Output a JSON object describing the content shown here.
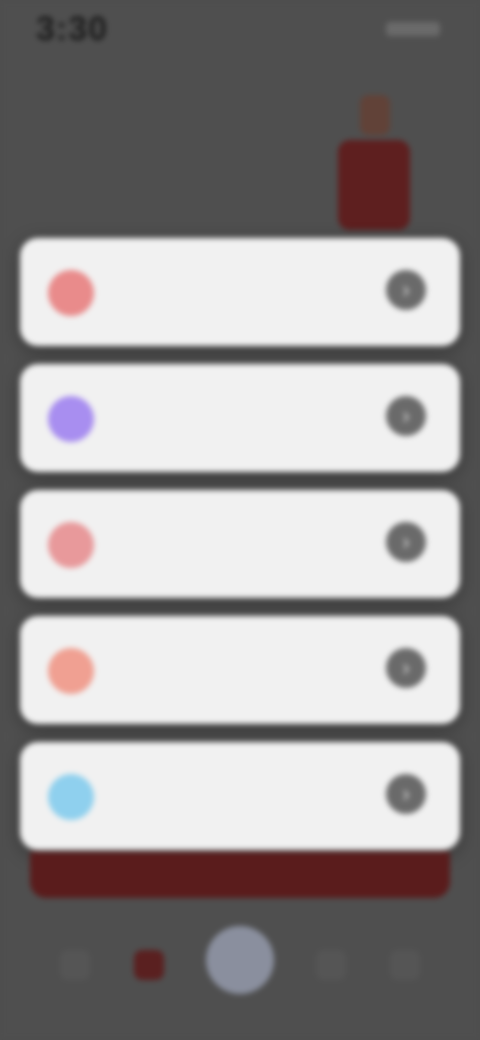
{
  "status_bar": {
    "time": "3:30"
  },
  "header": {
    "title": "",
    "graphic_color": "#5e1f1f"
  },
  "cards": [
    {
      "label": "",
      "icon": "status-dot-icon",
      "icon_color": "#e98b8b",
      "action_icon": "chevron-right-icon"
    },
    {
      "label": "",
      "icon": "status-dot-icon",
      "icon_color": "#a88ef0",
      "action_icon": "chevron-right-icon"
    },
    {
      "label": "",
      "icon": "status-dot-icon",
      "icon_color": "#e8999b",
      "action_icon": "chevron-right-icon"
    },
    {
      "label": "",
      "icon": "status-dot-icon",
      "icon_color": "#f0a092",
      "action_icon": "chevron-right-icon"
    },
    {
      "label": "",
      "icon": "status-dot-icon",
      "icon_color": "#8fd0ee",
      "action_icon": "chevron-right-icon"
    }
  ],
  "bottom_banner": {
    "color": "#5a1c1c"
  },
  "bottom_nav": {
    "items": [
      "home-icon",
      "stats-icon",
      "center-action-icon",
      "list-icon",
      "profile-icon"
    ],
    "active_index": 1,
    "center_color": "#8a8f9e"
  },
  "colors": {
    "background": "#4f4f4f",
    "card": "#f1f1f1",
    "accent": "#5e1f1f"
  }
}
